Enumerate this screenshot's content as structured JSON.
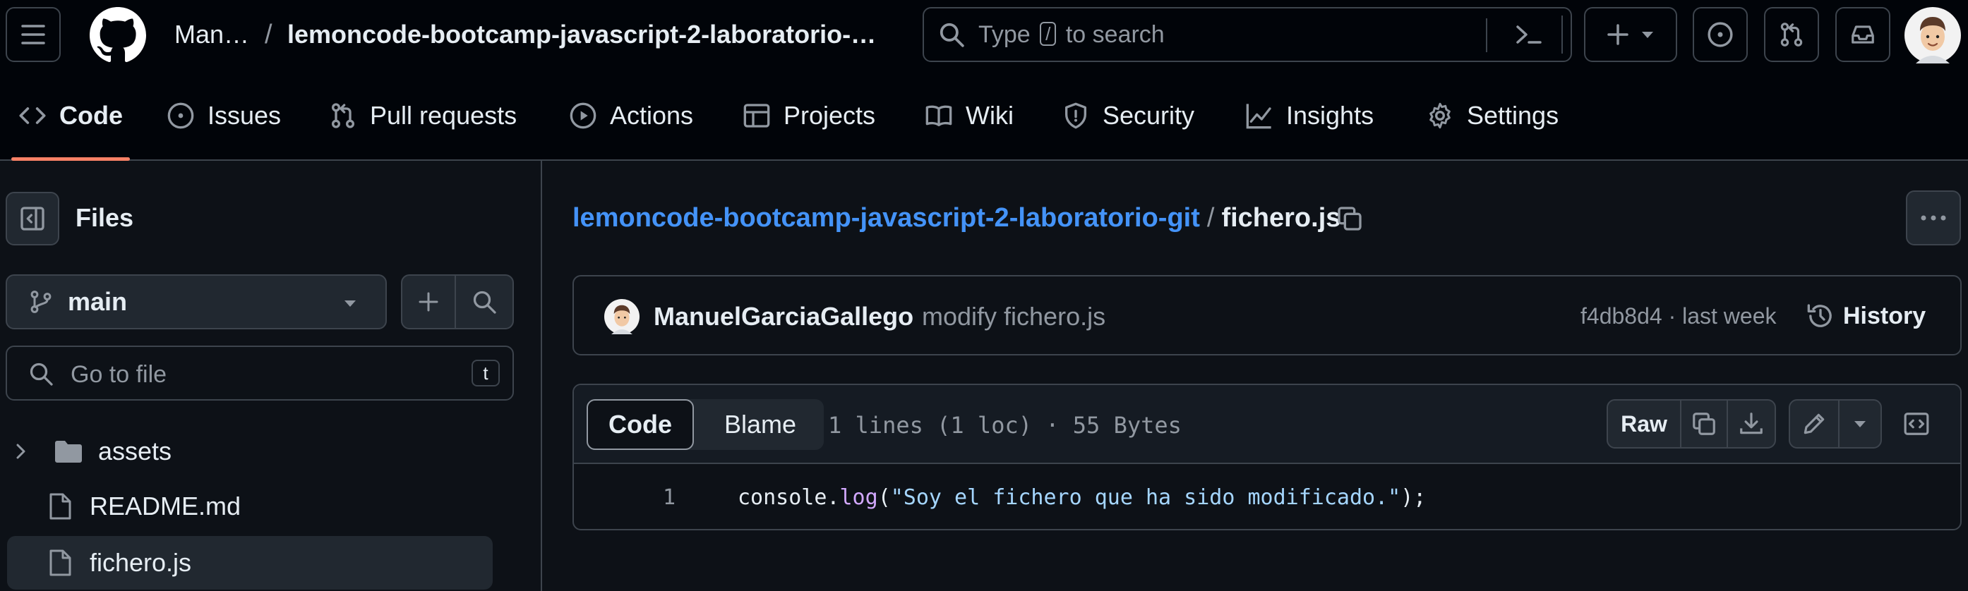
{
  "header": {
    "owner": "Man…",
    "separator": "/",
    "repo_name": "lemoncode-bootcamp-javascript-2-laboratorio-…",
    "search_prefix": "Type",
    "search_key": "/",
    "search_suffix": "to search"
  },
  "repo_nav": {
    "tabs": [
      {
        "label": "Code",
        "icon": "code-icon"
      },
      {
        "label": "Issues",
        "icon": "issue-opened-icon"
      },
      {
        "label": "Pull requests",
        "icon": "git-pull-request-icon"
      },
      {
        "label": "Actions",
        "icon": "play-icon"
      },
      {
        "label": "Projects",
        "icon": "table-icon"
      },
      {
        "label": "Wiki",
        "icon": "book-icon"
      },
      {
        "label": "Security",
        "icon": "shield-icon"
      },
      {
        "label": "Insights",
        "icon": "graph-icon"
      },
      {
        "label": "Settings",
        "icon": "gear-icon"
      }
    ]
  },
  "sidebar": {
    "title": "Files",
    "branch": "main",
    "go_to_file_placeholder": "Go to file",
    "go_to_file_shortcut": "t",
    "tree": [
      {
        "name": "assets",
        "type": "folder"
      },
      {
        "name": "README.md",
        "type": "file"
      },
      {
        "name": "fichero.js",
        "type": "file",
        "selected": true
      }
    ]
  },
  "breadcrumb": {
    "repo": "lemoncode-bootcamp-javascript-2-laboratorio-git",
    "separator": "/",
    "file": "fichero.js"
  },
  "commit": {
    "author": "ManuelGarciaGallego",
    "message": "modify fichero.js",
    "meta": "f4db8d4 · last week",
    "history_label": "History"
  },
  "file_view": {
    "tabs": {
      "code": "Code",
      "blame": "Blame"
    },
    "stats": "1 lines (1 loc) · 55 Bytes",
    "raw_label": "Raw",
    "lines": [
      {
        "number": "1",
        "obj": "console.",
        "fn": "log",
        "open": "(",
        "str": "\"Soy el fichero que ha sido modificado.\"",
        "close": ");"
      }
    ]
  },
  "colors": {
    "background": "#0d1117",
    "header": "#010409",
    "link": "#4493f8",
    "active_tab_underline": "#f78166",
    "border": "#3d444d"
  }
}
